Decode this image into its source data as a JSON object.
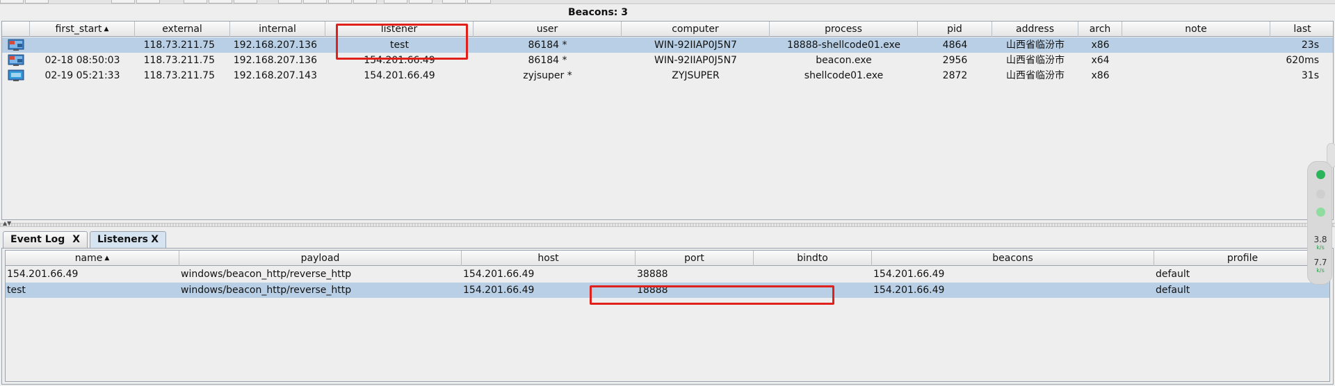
{
  "beacons": {
    "title": "Beacons: 3",
    "columns": [
      "",
      "first_start",
      "external",
      "internal",
      "listener",
      "user",
      "computer",
      "process",
      "pid",
      "address",
      "arch",
      "note",
      "last"
    ],
    "sort_indicator": "▲",
    "rows": [
      {
        "first_start": "",
        "external": "118.73.211.75",
        "internal": "192.168.207.136",
        "listener": "test",
        "user": "86184 *",
        "computer": "WIN-92IIAP0J5N7",
        "process": "18888-shellcode01.exe",
        "pid": "4864",
        "address": "山西省临汾市",
        "arch": "x86",
        "note": "",
        "last": "23s"
      },
      {
        "first_start": "02-18 08:50:03",
        "external": "118.73.211.75",
        "internal": "192.168.207.136",
        "listener": "154.201.66.49",
        "user": "86184 *",
        "computer": "WIN-92IIAP0J5N7",
        "process": "beacon.exe",
        "pid": "2956",
        "address": "山西省临汾市",
        "arch": "x64",
        "note": "",
        "last": "620ms"
      },
      {
        "first_start": "02-19 05:21:33",
        "external": "118.73.211.75",
        "internal": "192.168.207.143",
        "listener": "154.201.66.49",
        "user": "zyjsuper *",
        "computer": "ZYJSUPER",
        "process": "shellcode01.exe",
        "pid": "2872",
        "address": "山西省临汾市",
        "arch": "x86",
        "note": "",
        "last": "31s"
      }
    ]
  },
  "tabs": [
    {
      "label": "Event Log",
      "close": "X"
    },
    {
      "label": "Listeners",
      "close": "X"
    }
  ],
  "listeners": {
    "columns": [
      "name",
      "payload",
      "host",
      "port",
      "bindto",
      "beacons",
      "profile"
    ],
    "sort_indicator": "▲",
    "rows": [
      {
        "name": "154.201.66.49",
        "payload": "windows/beacon_http/reverse_http",
        "host": "154.201.66.49",
        "port": "38888",
        "bindto": "",
        "beacons": "154.201.66.49",
        "profile": "default"
      },
      {
        "name": "test",
        "payload": "windows/beacon_http/reverse_http",
        "host": "154.201.66.49",
        "port": "18888",
        "bindto": "",
        "beacons": "154.201.66.49",
        "profile": "default"
      }
    ]
  },
  "widget": {
    "upload": "3.8",
    "download": "7.7",
    "unit_up": "k/s",
    "unit_down": "k/s"
  },
  "colors": {
    "selected_row": "#b8cfe5",
    "highlight": "#e0201a",
    "status_green": "#2bb55a"
  }
}
